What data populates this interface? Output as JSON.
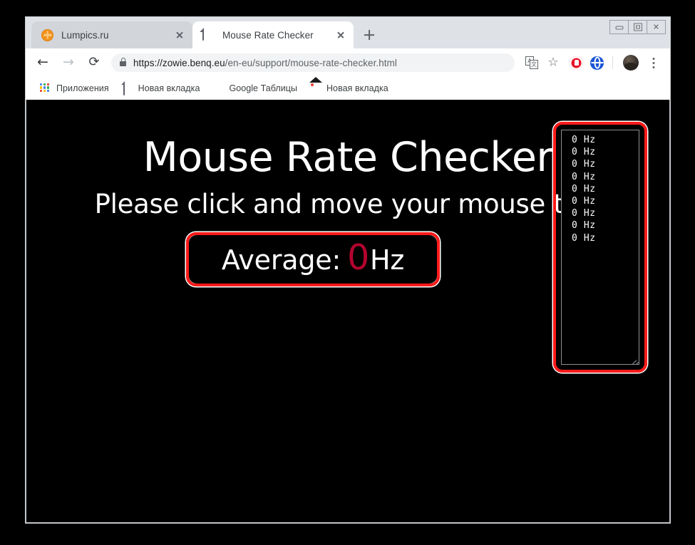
{
  "window": {
    "controls": {
      "minimize_label": "Minimize",
      "maximize_label": "Maximize",
      "close_label": "Close",
      "close_glyph": "✕"
    }
  },
  "tabs": [
    {
      "title": "Lumpics.ru",
      "favicon": "lumpics-favicon",
      "active": false,
      "close_label": "Close tab"
    },
    {
      "title": "Mouse Rate Checker",
      "favicon": "document-favicon",
      "active": true,
      "close_label": "Close tab"
    }
  ],
  "new_tab_label": "New tab",
  "toolbar": {
    "back_glyph": "←",
    "forward_glyph": "→",
    "reload_glyph": "⟳",
    "back_label": "Back",
    "forward_label": "Forward",
    "reload_label": "Reload",
    "url_host": "https://zowie.benq.eu",
    "url_path": "/en-eu/support/mouse-rate-checker.html",
    "url_full": "https://zowie.benq.eu/en-eu/support/mouse-rate-checker.html",
    "translate_a": "A",
    "translate_b": "文",
    "star_glyph": "☆",
    "menu_label": "Customize and control Google Chrome"
  },
  "bookmarks": [
    {
      "label": "Приложения",
      "icon": "apps-grid-icon"
    },
    {
      "label": "Новая вкладка",
      "icon": "document-icon"
    },
    {
      "label": "Google Таблицы",
      "icon": "google-sheets-icon"
    },
    {
      "label": "Новая вкладка",
      "icon": "image-icon"
    }
  ],
  "page": {
    "title": "Mouse Rate Checker",
    "subtitle": "Please click and move your mouse to s",
    "average_label": "Average:",
    "average_value": "0",
    "average_unit": "Hz",
    "rate_lines": [
      "0 Hz",
      "0 Hz",
      "0 Hz",
      "0 Hz",
      "0 Hz",
      "0 Hz",
      "0 Hz",
      "0 Hz",
      "0 Hz"
    ]
  },
  "colors": {
    "highlight_red": "#fc1a1a",
    "average_value_red": "#b3052e",
    "page_background": "#000000",
    "tabstrip_background": "#dee1e6"
  }
}
